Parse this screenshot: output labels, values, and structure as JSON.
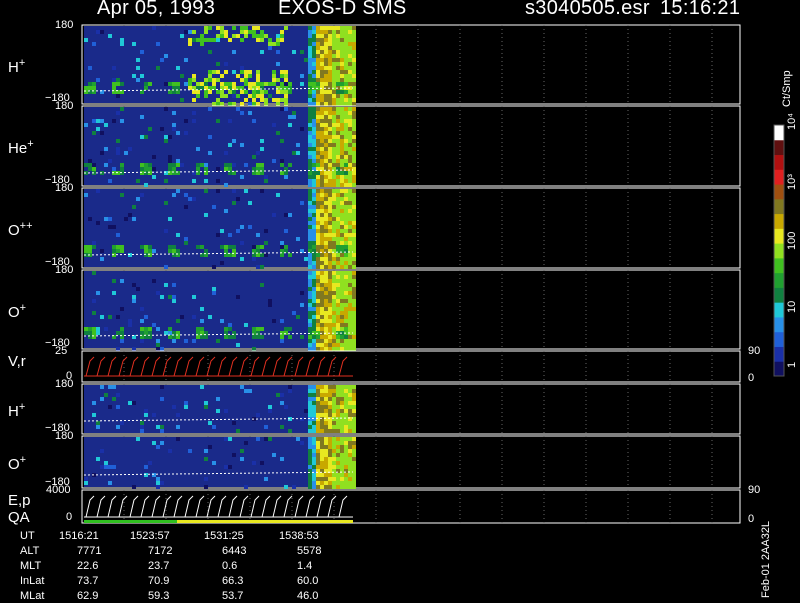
{
  "header": {
    "date": "Apr 05, 1993",
    "mission": "EXOS-D SMS",
    "filename": "s3040505.esr",
    "time": "15:16:21"
  },
  "colorbar": {
    "unit": "Ct/Smp",
    "ticks": [
      "1",
      "10",
      "100",
      "10³",
      "10⁴"
    ],
    "colors": [
      "#101060",
      "#1a30a8",
      "#2060d8",
      "#2890e8",
      "#20c8d8",
      "#108040",
      "#20a030",
      "#40c020",
      "#90e020",
      "#e8e820",
      "#c8a800",
      "#807820",
      "#a05010",
      "#e02020",
      "#b01010",
      "#601010",
      "#ffffff"
    ]
  },
  "panels": [
    {
      "species": "H",
      "charge": "+",
      "ymax": "180",
      "ymin": "−180"
    },
    {
      "species": "He",
      "charge": "+",
      "ymax": "180",
      "ymin": "−180"
    },
    {
      "species": "O",
      "charge": "++",
      "ymax": "180",
      "ymin": "−180"
    },
    {
      "species": "O",
      "charge": "+",
      "ymax": "180",
      "ymin": "−180"
    },
    {
      "species": "V,r",
      "charge": "",
      "ymax": "25",
      "ymin": "0",
      "right_max": "90",
      "right_min": "0"
    },
    {
      "species": "H",
      "charge": "+",
      "ymax": "180",
      "ymin": "−180"
    },
    {
      "species": "O",
      "charge": "+",
      "ymax": "180",
      "ymin": "−180"
    },
    {
      "species": "E,p",
      "charge": "",
      "ymax": "4000",
      "ymin": "0",
      "right_max": "90",
      "right_min": "0"
    }
  ],
  "qa_label": "QA",
  "ephemeris": {
    "rows": [
      {
        "label": "UT",
        "values": [
          "1516:21",
          "1523:57",
          "1531:25",
          "1538:53"
        ]
      },
      {
        "label": "ALT",
        "values": [
          "7771",
          "7172",
          "6443",
          "5578"
        ]
      },
      {
        "label": "MLT",
        "values": [
          "22.6",
          "23.7",
          "0.6",
          "1.4"
        ]
      },
      {
        "label": "InLat",
        "values": [
          "73.7",
          "70.9",
          "66.3",
          "60.0"
        ]
      },
      {
        "label": "MLat",
        "values": [
          "62.9",
          "59.3",
          "53.7",
          "46.0"
        ]
      }
    ]
  },
  "footer_vertical": "Feb-01 2AA32L",
  "chart_data": {
    "type": "heatmap",
    "title": "Apr 05, 1993   EXOS-D SMS",
    "x_ticks_ut": [
      "1516:21",
      "1523:57",
      "1531:25",
      "1538:53"
    ],
    "panel_labels": [
      "H+",
      "He+",
      "O++",
      "O+",
      "V,r",
      "H+",
      "O+",
      "E,p"
    ],
    "ylim_pitch": [
      -180,
      180
    ],
    "ylim_vr": [
      0,
      25
    ],
    "ylim_ep": [
      0,
      4000
    ],
    "colorbar_range": [
      1,
      10000
    ],
    "colorbar_scale": "log",
    "grid": true
  }
}
